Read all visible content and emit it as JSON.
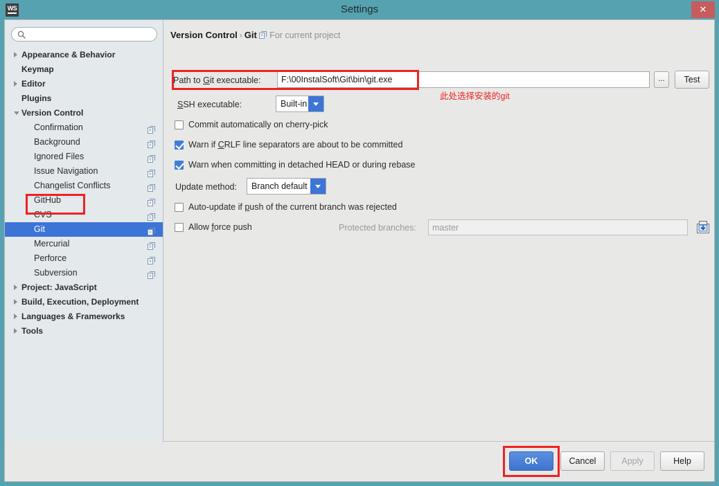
{
  "window": {
    "app_icon": "webstorm-logo",
    "app_initials": "WS",
    "title": "Settings",
    "close_label": "✕"
  },
  "search": {
    "icon": "search-icon",
    "value": "",
    "placeholder": ""
  },
  "sidebar": {
    "items": [
      {
        "label": "Appearance & Behavior",
        "level": 0,
        "type": "group",
        "arrow": "collapsed",
        "icon": null,
        "selected": false
      },
      {
        "label": "Keymap",
        "level": 0,
        "type": "group",
        "arrow": "none",
        "icon": null,
        "selected": false
      },
      {
        "label": "Editor",
        "level": 0,
        "type": "group",
        "arrow": "collapsed",
        "icon": null,
        "selected": false
      },
      {
        "label": "Plugins",
        "level": 0,
        "type": "group",
        "arrow": "none",
        "icon": null,
        "selected": false
      },
      {
        "label": "Version Control",
        "level": 0,
        "type": "group",
        "arrow": "expanded",
        "icon": null,
        "selected": false
      },
      {
        "label": "Confirmation",
        "level": 1,
        "type": "leaf",
        "arrow": "none",
        "icon": "project-scope-icon",
        "selected": false
      },
      {
        "label": "Background",
        "level": 1,
        "type": "leaf",
        "arrow": "none",
        "icon": "project-scope-icon",
        "selected": false
      },
      {
        "label": "Ignored Files",
        "level": 1,
        "type": "leaf",
        "arrow": "none",
        "icon": "project-scope-icon",
        "selected": false
      },
      {
        "label": "Issue Navigation",
        "level": 1,
        "type": "leaf",
        "arrow": "none",
        "icon": "project-scope-icon",
        "selected": false
      },
      {
        "label": "Changelist Conflicts",
        "level": 1,
        "type": "leaf",
        "arrow": "none",
        "icon": "project-scope-icon",
        "selected": false
      },
      {
        "label": "GitHub",
        "level": 1,
        "type": "leaf",
        "arrow": "none",
        "icon": "project-scope-icon",
        "selected": false
      },
      {
        "label": "CVS",
        "level": 1,
        "type": "leaf",
        "arrow": "none",
        "icon": "project-scope-icon",
        "selected": false
      },
      {
        "label": "Git",
        "level": 1,
        "type": "leaf",
        "arrow": "none",
        "icon": "project-scope-icon",
        "selected": true
      },
      {
        "label": "Mercurial",
        "level": 1,
        "type": "leaf",
        "arrow": "none",
        "icon": "project-scope-icon",
        "selected": false
      },
      {
        "label": "Perforce",
        "level": 1,
        "type": "leaf",
        "arrow": "none",
        "icon": "project-scope-icon",
        "selected": false
      },
      {
        "label": "Subversion",
        "level": 1,
        "type": "leaf",
        "arrow": "none",
        "icon": "project-scope-icon",
        "selected": false
      },
      {
        "label": "Project: JavaScript",
        "level": 0,
        "type": "group",
        "arrow": "collapsed",
        "icon": null,
        "selected": false
      },
      {
        "label": "Build, Execution, Deployment",
        "level": 0,
        "type": "group",
        "arrow": "collapsed",
        "icon": null,
        "selected": false
      },
      {
        "label": "Languages & Frameworks",
        "level": 0,
        "type": "group",
        "arrow": "collapsed",
        "icon": null,
        "selected": false
      },
      {
        "label": "Tools",
        "level": 0,
        "type": "group",
        "arrow": "collapsed",
        "icon": null,
        "selected": false
      }
    ]
  },
  "breadcrumb": {
    "parent": "Version Control",
    "separator": "›",
    "current": "Git",
    "scope_icon": "project-scope-icon",
    "scope_text": "For current project"
  },
  "form": {
    "git_path": {
      "label_prefix": "Path to ",
      "label_mnemonic": "G",
      "label_suffix": "it executable:",
      "label_full": "Path to Git executable:",
      "value": "F:\\00InstalSoft\\Git\\bin\\git.exe",
      "browse_label": "...",
      "test_label": "Test"
    },
    "ssh": {
      "label_prefix": "S",
      "label_mnemonic": "S",
      "label_full": "SSH executable:",
      "value": "Built-in"
    },
    "cherry_pick": {
      "label": "Commit automatically on cherry-pick",
      "checked": false
    },
    "crlf_warn": {
      "label": "Warn if CRLF line separators are about to be committed",
      "checked": true
    },
    "detached_head_warn": {
      "label": "Warn when committing in detached HEAD or during rebase",
      "checked": true
    },
    "update_method": {
      "label": "Update method:",
      "value": "Branch default"
    },
    "auto_update": {
      "label": "Auto-update if push of the current branch was rejected",
      "checked": false
    },
    "allow_force_push": {
      "label": "Allow force push",
      "checked": false
    },
    "protected_branches": {
      "label": "Protected branches:",
      "value": "master",
      "enabled": false,
      "expand_icon": "expand-list-icon"
    }
  },
  "annotations": {
    "git_path_note": "此处选择安装的git",
    "highlight_color": "#ee2222"
  },
  "footer": {
    "ok": "OK",
    "cancel": "Cancel",
    "apply": "Apply",
    "apply_enabled": false,
    "help": "Help"
  },
  "colors": {
    "window_chrome": "#56a2b0",
    "dialog_bg": "#e8e8e7",
    "sidebar_bg": "#e4e9ec",
    "selection_blue": "#3d74d8",
    "accent_blue": "#3f7fd6",
    "close_red": "#c75c5c",
    "annotation_red": "#ee2222"
  }
}
